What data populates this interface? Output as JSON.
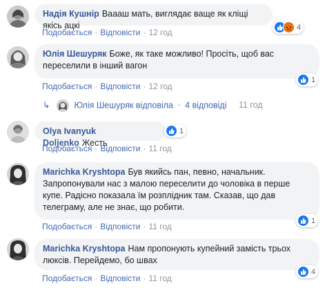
{
  "actions": {
    "like": "Подобається",
    "reply": "Відповісти",
    "sep": "·"
  },
  "comments": [
    {
      "author": "Надія Кушнір",
      "text": "Ваааш мать, виглядає ваще як кліщі якісь ацкі",
      "time": "12 год",
      "reactions": [
        "like-icon",
        "angry-icon"
      ],
      "count": "4"
    },
    {
      "author": "Юлія Шешуряк",
      "text_line1": "Боже, як таке можливо! Просіть, щоб вас",
      "text_line2": "переселили в інший вагон",
      "time": "12 год",
      "reactions": [
        "like-icon"
      ],
      "count": "1"
    },
    {
      "author": "Olya Ivanyuk Doljenko",
      "text": "Жесть",
      "time": "11 год",
      "reactions": [
        "like-icon"
      ],
      "count": "1"
    },
    {
      "author": "Marichka Kryshtopa",
      "text_line1": "Був якийсь пан, певно, начальник.",
      "text_line2": "Запропонували нас з малою переселити до чоловіка в перше",
      "text_line3": "купе. Радісно показала їм розплідник там. Сказав, що дав",
      "text_line4": "телеграму, але не знає, що робити.",
      "time": "11 год",
      "reactions": [
        "like-icon"
      ],
      "count": "1"
    },
    {
      "author": "Marichka Kryshtopa",
      "text_line1": "Нам пропонують купейний замість трьох",
      "text_line2": "люксів. Перейдемо, бо швах",
      "time": "11 год",
      "reactions": [
        "like-icon"
      ],
      "count": "4"
    }
  ],
  "reply_summary": {
    "arrow": "↳",
    "who": "Юлія Шешуряк відповіла",
    "dot": "·",
    "count": "4 відповіді",
    "time": "11 год"
  }
}
